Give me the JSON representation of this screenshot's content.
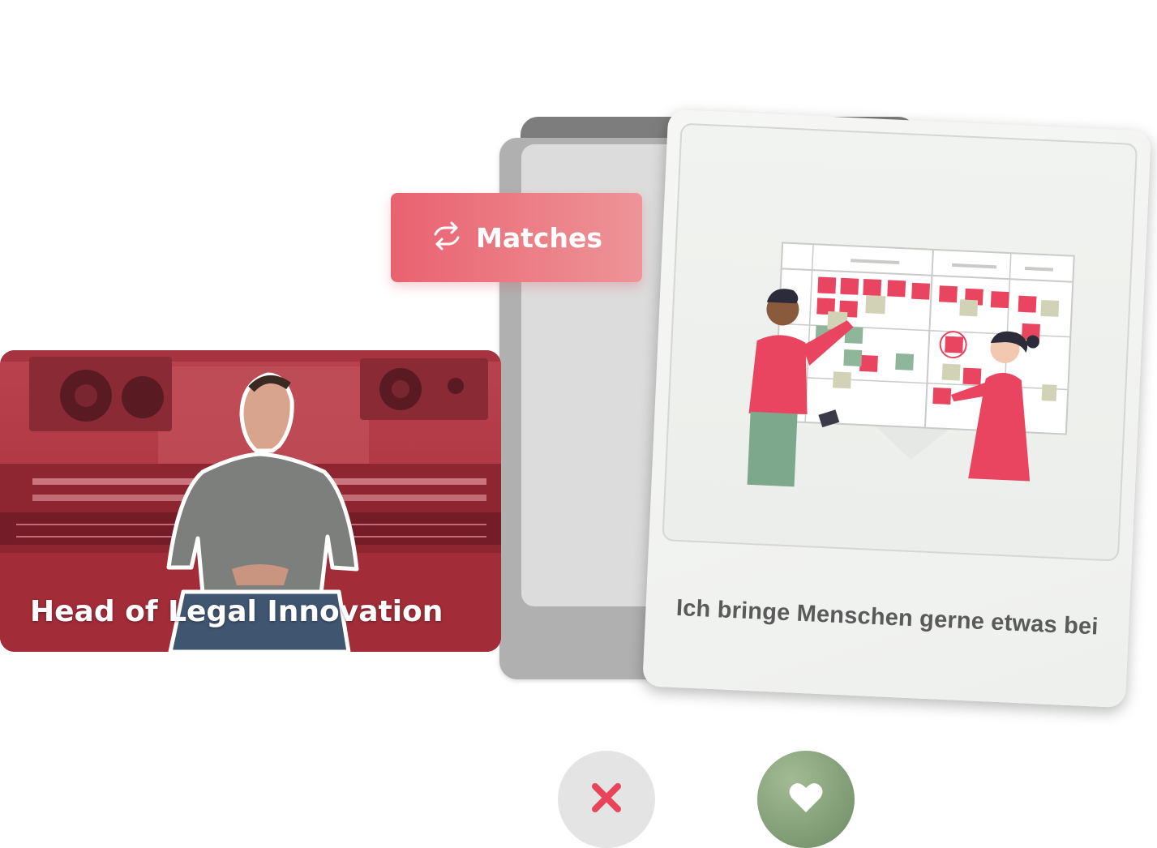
{
  "matches_button": {
    "label": "Matches",
    "icon": "swap-arrows-icon"
  },
  "profile_card": {
    "title": "Head of Legal Innovation",
    "image": "person-in-recording-studio"
  },
  "question_card": {
    "caption": "Ich bringe Menschen gerne etwas bei",
    "illustration": "kanban-board-illustration"
  },
  "actions": {
    "reject_icon": "close-icon",
    "like_icon": "heart-icon"
  },
  "colors": {
    "accent": "#e96270",
    "like": "#7d9a73",
    "reject_x": "#e8455c",
    "profile_overlay": "#b43340"
  }
}
